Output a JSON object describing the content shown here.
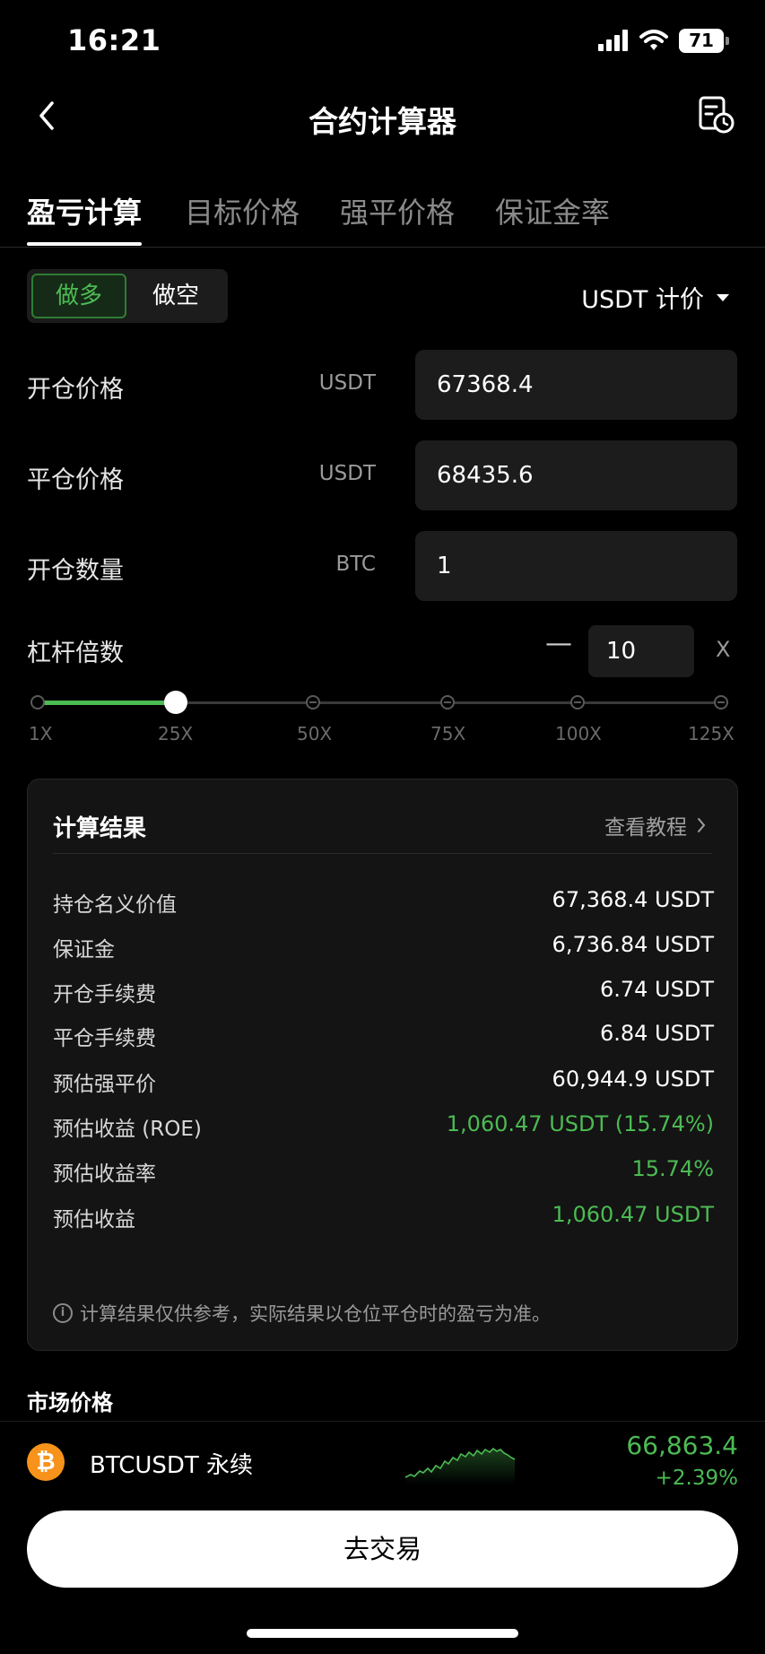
{
  "status": {
    "time": "16:21",
    "battery": "71"
  },
  "nav": {
    "title": "合约计算器"
  },
  "tabs": [
    {
      "label": "盈亏计算"
    },
    {
      "label": "目标价格"
    },
    {
      "label": "强平价格"
    },
    {
      "label": "保证金率"
    }
  ],
  "side": {
    "long": "做多",
    "short": "做空",
    "unit_select": "USDT 计价"
  },
  "fields": {
    "open_price": {
      "label": "开仓价格",
      "unit": "USDT",
      "value": "67368.4"
    },
    "close_price": {
      "label": "平仓价格",
      "unit": "USDT",
      "value": "68435.6"
    },
    "quantity": {
      "label": "开仓数量",
      "unit": "BTC",
      "value": "1"
    }
  },
  "leverage": {
    "label": "杠杆倍数",
    "minus": "—",
    "value": "10",
    "suffix": "X",
    "ticks": [
      "1X",
      "25X",
      "50X",
      "75X",
      "100X",
      "125X"
    ],
    "max": 125
  },
  "result": {
    "title": "计算结果",
    "tutorial": "查看教程",
    "rows": [
      {
        "key": "持仓名义价值",
        "value": "67,368.4  USDT"
      },
      {
        "key": "保证金",
        "value": "6,736.84  USDT"
      },
      {
        "key": "开仓手续费",
        "value": "6.74  USDT"
      },
      {
        "key": "平仓手续费",
        "value": "6.84  USDT"
      },
      {
        "key": "预估强平价",
        "value": "60,944.9  USDT"
      },
      {
        "key": "预估收益 (ROE)",
        "value": "1,060.47 USDT (15.74%)"
      },
      {
        "key": "预估收益率",
        "value": "15.74%"
      },
      {
        "key": "预估收益",
        "value": "1,060.47 USDT"
      }
    ],
    "note": "计算结果仅供参考，实际结果以仓位平仓时的盈亏为准。"
  },
  "market": {
    "title": "市场价格",
    "symbol_icon": "₿",
    "name": "BTCUSDT 永续",
    "price": "66,863.4",
    "change": "+2.39%"
  },
  "trade_button": "去交易",
  "colors": {
    "accent_green": "#4cbb53",
    "background": "#000000",
    "card": "#141414"
  },
  "icons": {
    "back": "chevron-left-icon",
    "record": "record-clock-icon",
    "info": "info-icon",
    "tutorial": "chevron-right-icon",
    "caret": "caret-down-icon"
  }
}
